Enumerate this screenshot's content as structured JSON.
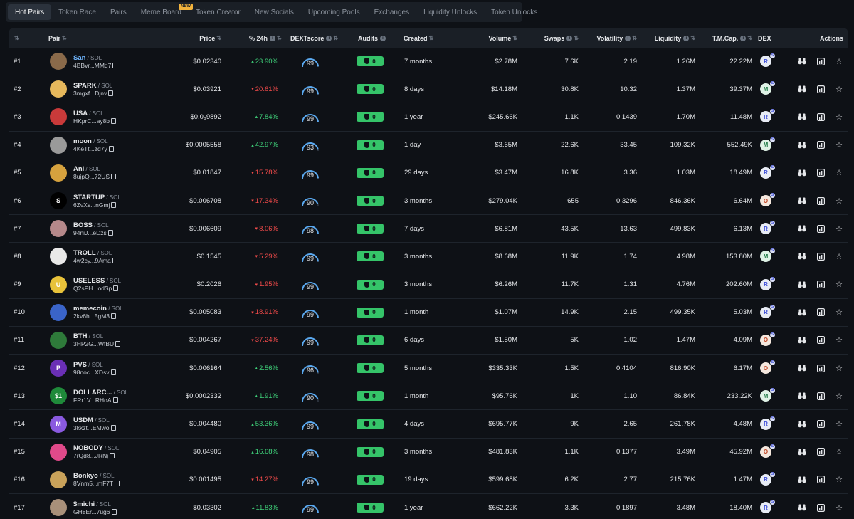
{
  "tabs": [
    {
      "label": "Hot Pairs",
      "active": true
    },
    {
      "label": "Token Race"
    },
    {
      "label": "Pairs"
    },
    {
      "label": "Meme Board",
      "badge": "NEW"
    },
    {
      "label": "Token Creator"
    },
    {
      "label": "New Socials"
    },
    {
      "label": "Upcoming Pools"
    },
    {
      "label": "Exchanges"
    },
    {
      "label": "Liquidity Unlocks"
    },
    {
      "label": "Token Unlocks"
    }
  ],
  "columns": {
    "pair": "Pair",
    "price": "Price",
    "change": "% 24h",
    "score": "DEXTscore",
    "audits": "Audits",
    "created": "Created",
    "volume": "Volume",
    "swaps": "Swaps",
    "volatility": "Volatility",
    "liquidity": "Liquidity",
    "mcap": "T.M.Cap.",
    "dex": "DEX",
    "actions": "Actions"
  },
  "colors": {
    "positive": "#3fd17a",
    "negative": "#f04a4a",
    "audit_green": "#35c469",
    "gauge_blue": "#5aa9f0"
  },
  "rows": [
    {
      "rank": "#1",
      "name": "San",
      "highlight": true,
      "quote": "SOL",
      "addr": "4BBvr...MMq7",
      "price": "$0.02340",
      "change": "23.90%",
      "dir": "up",
      "score": "99",
      "audit": "0",
      "created": "7 months",
      "volume": "$2.78M",
      "swaps": "7.6K",
      "volatility": "2.19",
      "liquidity": "1.26M",
      "mcap": "22.22M",
      "dex": "raydium",
      "avatar_color": "#8a6a4a",
      "avatar_text": ""
    },
    {
      "rank": "#2",
      "name": "SPARK",
      "quote": "SOL",
      "addr": "3mgxf...Djnv",
      "price": "$0.03921",
      "change": "20.61%",
      "dir": "down",
      "score": "99",
      "audit": "0",
      "created": "8 days",
      "volume": "$14.18M",
      "swaps": "30.8K",
      "volatility": "10.32",
      "liquidity": "1.37M",
      "mcap": "39.37M",
      "dex": "meteora",
      "avatar_color": "#e6b85c",
      "avatar_text": ""
    },
    {
      "rank": "#3",
      "name": "USA",
      "quote": "SOL",
      "addr": "HKprC...ay8b",
      "price": "$0.0₈9892",
      "change": "7.84%",
      "dir": "up",
      "score": "99",
      "audit": "0",
      "created": "1 year",
      "volume": "$245.66K",
      "swaps": "1.1K",
      "volatility": "0.1439",
      "liquidity": "1.70M",
      "mcap": "11.48M",
      "dex": "raydium",
      "avatar_color": "#c93a3a",
      "avatar_text": ""
    },
    {
      "rank": "#4",
      "name": "moon",
      "quote": "SOL",
      "addr": "4KeTt...zd7y",
      "price": "$0.0005558",
      "change": "42.97%",
      "dir": "up",
      "score": "93",
      "audit": "0",
      "created": "1 day",
      "volume": "$3.65M",
      "swaps": "22.6K",
      "volatility": "33.45",
      "liquidity": "109.32K",
      "mcap": "552.49K",
      "dex": "meteora",
      "avatar_color": "#9a9a9a",
      "avatar_text": ""
    },
    {
      "rank": "#5",
      "name": "Ani",
      "quote": "SOL",
      "addr": "8ujpQ...72US",
      "price": "$0.01847",
      "change": "15.78%",
      "dir": "down",
      "score": "99",
      "audit": "0",
      "created": "29 days",
      "volume": "$3.47M",
      "swaps": "16.8K",
      "volatility": "3.36",
      "liquidity": "1.03M",
      "mcap": "18.49M",
      "dex": "raydium",
      "avatar_color": "#d6a23e",
      "avatar_text": ""
    },
    {
      "rank": "#6",
      "name": "STARTUP",
      "quote": "SOL",
      "addr": "6ZvXs...nGmj",
      "price": "$0.006708",
      "change": "17.34%",
      "dir": "down",
      "score": "90",
      "audit": "0",
      "created": "3 months",
      "volume": "$279.04K",
      "swaps": "655",
      "volatility": "0.3296",
      "liquidity": "846.36K",
      "mcap": "6.64M",
      "dex": "orca",
      "avatar_color": "#000000",
      "avatar_text": "S"
    },
    {
      "rank": "#7",
      "name": "BOSS",
      "quote": "SOL",
      "addr": "94niJ...eDzs",
      "price": "$0.006609",
      "change": "8.06%",
      "dir": "down",
      "score": "98",
      "audit": "0",
      "created": "7 days",
      "volume": "$6.81M",
      "swaps": "43.5K",
      "volatility": "13.63",
      "liquidity": "499.83K",
      "mcap": "6.13M",
      "dex": "raydium",
      "avatar_color": "#b5888a",
      "avatar_text": ""
    },
    {
      "rank": "#8",
      "name": "TROLL",
      "quote": "SOL",
      "addr": "4w2cy...9Ama",
      "price": "$0.1545",
      "change": "5.29%",
      "dir": "down",
      "score": "99",
      "audit": "0",
      "created": "3 months",
      "volume": "$8.68M",
      "swaps": "11.9K",
      "volatility": "1.74",
      "liquidity": "4.98M",
      "mcap": "153.80M",
      "dex": "meteora",
      "avatar_color": "#e9e9e9",
      "avatar_text": ""
    },
    {
      "rank": "#9",
      "name": "USELESS",
      "quote": "SOL",
      "addr": "Q2sPH...odSp",
      "price": "$0.2026",
      "change": "1.95%",
      "dir": "down",
      "score": "99",
      "audit": "0",
      "created": "3 months",
      "volume": "$6.26M",
      "swaps": "11.7K",
      "volatility": "1.31",
      "liquidity": "4.76M",
      "mcap": "202.60M",
      "dex": "raydium",
      "avatar_color": "#e8c23a",
      "avatar_text": "U"
    },
    {
      "rank": "#10",
      "name": "memecoin",
      "quote": "SOL",
      "addr": "2kv6h...5gM3",
      "price": "$0.005083",
      "change": "18.91%",
      "dir": "down",
      "score": "99",
      "audit": "0",
      "created": "1 month",
      "volume": "$1.07M",
      "swaps": "14.9K",
      "volatility": "2.15",
      "liquidity": "499.35K",
      "mcap": "5.03M",
      "dex": "raydium",
      "avatar_color": "#3a64c9",
      "avatar_text": ""
    },
    {
      "rank": "#11",
      "name": "BTH",
      "quote": "SOL",
      "addr": "3HP2G...WfBU",
      "price": "$0.004267",
      "change": "37.24%",
      "dir": "down",
      "score": "99",
      "audit": "0",
      "created": "6 days",
      "volume": "$1.50M",
      "swaps": "5K",
      "volatility": "1.02",
      "liquidity": "1.47M",
      "mcap": "4.09M",
      "dex": "orca",
      "avatar_color": "#2e7a3a",
      "avatar_text": ""
    },
    {
      "rank": "#12",
      "name": "PVS",
      "quote": "SOL",
      "addr": "98noc...XDsv",
      "price": "$0.006164",
      "change": "2.56%",
      "dir": "up",
      "score": "96",
      "audit": "0",
      "created": "5 months",
      "volume": "$335.33K",
      "swaps": "1.5K",
      "volatility": "0.4104",
      "liquidity": "816.90K",
      "mcap": "6.17M",
      "dex": "orca",
      "avatar_color": "#6a2fb5",
      "avatar_text": "P"
    },
    {
      "rank": "#13",
      "name": "DOLLARC...",
      "quote": "SOL",
      "addr": "FRr1V...RHoA",
      "price": "$0.0002332",
      "change": "1.91%",
      "dir": "up",
      "score": "90",
      "audit": "0",
      "created": "1 month",
      "volume": "$95.76K",
      "swaps": "1K",
      "volatility": "1.10",
      "liquidity": "86.84K",
      "mcap": "233.22K",
      "dex": "meteora",
      "avatar_color": "#1f8a3a",
      "avatar_text": "$1"
    },
    {
      "rank": "#14",
      "name": "USDM",
      "quote": "SOL",
      "addr": "3kkzt...EMwo",
      "price": "$0.004480",
      "change": "53.36%",
      "dir": "up",
      "score": "99",
      "audit": "0",
      "created": "4 days",
      "volume": "$695.77K",
      "swaps": "9K",
      "volatility": "2.65",
      "liquidity": "261.78K",
      "mcap": "4.48M",
      "dex": "raydium",
      "avatar_color": "#8a5ae0",
      "avatar_text": "M"
    },
    {
      "rank": "#15",
      "name": "NOBODY",
      "quote": "SOL",
      "addr": "7rQd8...JRNj",
      "price": "$0.04905",
      "change": "16.68%",
      "dir": "up",
      "score": "98",
      "audit": "0",
      "created": "3 months",
      "volume": "$481.83K",
      "swaps": "1.1K",
      "volatility": "0.1377",
      "liquidity": "3.49M",
      "mcap": "45.92M",
      "dex": "orca",
      "avatar_color": "#e04a8a",
      "avatar_text": ""
    },
    {
      "rank": "#16",
      "name": "Bonkyo",
      "quote": "SOL",
      "addr": "8Vnm5...mF7T",
      "price": "$0.001495",
      "change": "14.27%",
      "dir": "down",
      "score": "99",
      "audit": "0",
      "created": "19 days",
      "volume": "$599.68K",
      "swaps": "6.2K",
      "volatility": "2.77",
      "liquidity": "215.76K",
      "mcap": "1.47M",
      "dex": "raydium",
      "avatar_color": "#c9a25a",
      "avatar_text": ""
    },
    {
      "rank": "#17",
      "name": "$michi",
      "quote": "SOL",
      "addr": "GH8Er...7ug6",
      "price": "$0.03302",
      "change": "11.83%",
      "dir": "up",
      "score": "99",
      "audit": "0",
      "created": "1 year",
      "volume": "$662.22K",
      "swaps": "3.3K",
      "volatility": "0.1897",
      "liquidity": "3.48M",
      "mcap": "18.40M",
      "dex": "raydium",
      "avatar_color": "#a8907a",
      "avatar_text": ""
    }
  ]
}
